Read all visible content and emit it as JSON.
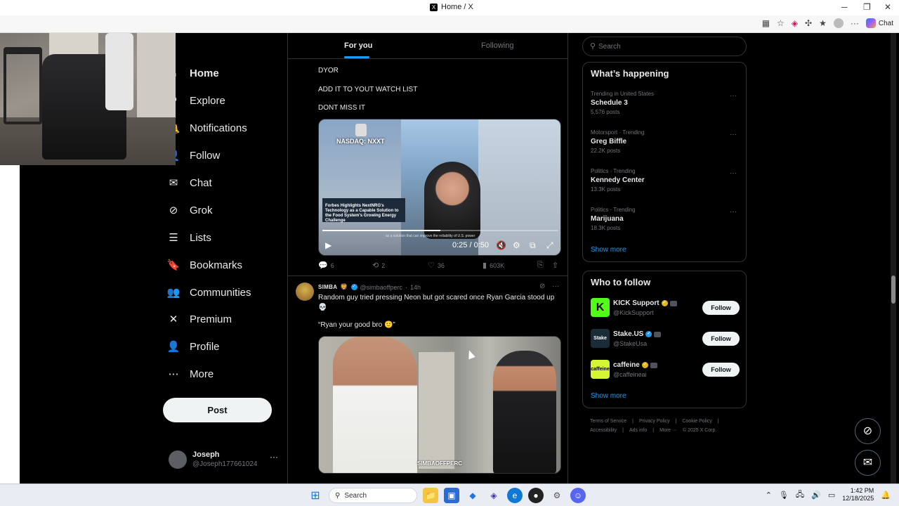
{
  "window": {
    "title": "Home / X",
    "logo": "X"
  },
  "browser": {
    "chat_label": "Chat"
  },
  "nav": {
    "items": [
      {
        "label": "Home",
        "icon": "home-icon",
        "glyph": "⌂"
      },
      {
        "label": "Explore",
        "icon": "search-icon",
        "glyph": "⚲"
      },
      {
        "label": "Notifications",
        "icon": "bell-icon",
        "glyph": "🔔"
      },
      {
        "label": "Follow",
        "icon": "person-add-icon",
        "glyph": "👤"
      },
      {
        "label": "Chat",
        "icon": "mail-icon",
        "glyph": "✉"
      },
      {
        "label": "Grok",
        "icon": "grok-icon",
        "glyph": "⊘"
      },
      {
        "label": "Lists",
        "icon": "list-icon",
        "glyph": "☰"
      },
      {
        "label": "Bookmarks",
        "icon": "bookmark-icon",
        "glyph": "🔖"
      },
      {
        "label": "Communities",
        "icon": "people-icon",
        "glyph": "👥"
      },
      {
        "label": "Premium",
        "icon": "x-logo-icon",
        "glyph": "✕"
      },
      {
        "label": "Profile",
        "icon": "profile-icon",
        "glyph": "👤"
      },
      {
        "label": "More",
        "icon": "more-circle-icon",
        "glyph": "⋯"
      }
    ],
    "post_label": "Post"
  },
  "account": {
    "name": "Joseph",
    "handle": "@Joseph177661024",
    "more": "···"
  },
  "feed": {
    "tabs": [
      "For you",
      "Following"
    ],
    "tweet1": {
      "lines": [
        "DYOR",
        "ADD IT TO YOUT WATCH LIST",
        "DONT MISS IT"
      ],
      "video": {
        "badge": "NASDAQ: NXXT",
        "caption": "Forbes Highlights NextNRG's Technology as a Capable Solution to the Food System's Growing Energy Challenge",
        "subtitle": "as a solution that can improve the reliability of U.S. power",
        "time": "0:25 / 0:50",
        "progress": 0.5
      },
      "replies": "6",
      "reposts": "2",
      "likes": "36",
      "views": "603K"
    },
    "tweet2": {
      "name": "SIMBA",
      "handle": "@simbaoffperc",
      "age": "14h",
      "text": "Random guy tried pressing Neon but got scared once Ryan Garcia stood up 💀",
      "quote": "“Ryan your good bro 🙂”",
      "watermark": "SIMBAOFFPERC"
    }
  },
  "sidebar": {
    "search_placeholder": "Search",
    "happening_title": "What’s happening",
    "trends": [
      {
        "category": "Trending in United States",
        "title": "Schedule 3",
        "posts": "5,576 posts"
      },
      {
        "category": "Motorsport · Trending",
        "title": "Greg Biffle",
        "posts": "22.2K posts"
      },
      {
        "category": "Politics · Trending",
        "title": "Kennedy Center",
        "posts": "13.3K posts"
      },
      {
        "category": "Politics · Trending",
        "title": "Marijuana",
        "posts": "18.3K posts"
      }
    ],
    "show_more": "Show more",
    "wtf_title": "Who to follow",
    "who_to_follow": [
      {
        "name": "KICK Support",
        "handle": "@KickSupport",
        "color": "#53fc18",
        "logo": "K"
      },
      {
        "name": "Stake.US",
        "handle": "@StakeUsa",
        "color": "#1a2c38",
        "logo": "Stake"
      },
      {
        "name": "caffeine",
        "handle": "@caffeineai",
        "color": "#d4f532",
        "logo": "caffeine"
      }
    ],
    "follow_label": "Follow",
    "footer": [
      "Terms of Service",
      "|",
      "Privacy Policy",
      "|",
      "Cookie Policy",
      "|",
      "Accessibility",
      "|",
      "Ads info",
      "|",
      "More ···",
      "© 2025 X Corp."
    ]
  },
  "taskbar": {
    "search_label": "Search",
    "time": "1:42 PM",
    "date": "12/18/2025"
  }
}
